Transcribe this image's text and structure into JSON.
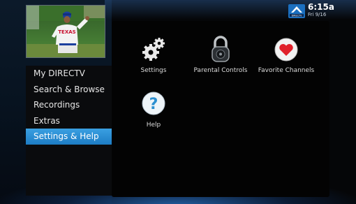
{
  "status": {
    "time": "6:15a",
    "date": "Fri 9/16",
    "logo_text": "DIRECTV"
  },
  "preview": {
    "jersey_text": "TEXAS"
  },
  "menu": {
    "items": [
      {
        "label": "My DIRECTV"
      },
      {
        "label": "Search & Browse"
      },
      {
        "label": "Recordings"
      },
      {
        "label": "Extras"
      },
      {
        "label": "Settings & Help",
        "selected": true
      }
    ]
  },
  "options": [
    {
      "label": "Settings",
      "icon": "gears-icon"
    },
    {
      "label": "Parental Controls",
      "icon": "padlock-icon"
    },
    {
      "label": "Favorite Channels",
      "icon": "heart-icon"
    },
    {
      "label": "Help",
      "icon": "question-mark-icon"
    }
  ],
  "colors": {
    "highlight": "#2a8fd6",
    "heart": "#e0202a",
    "help": "#2b8fd0"
  }
}
